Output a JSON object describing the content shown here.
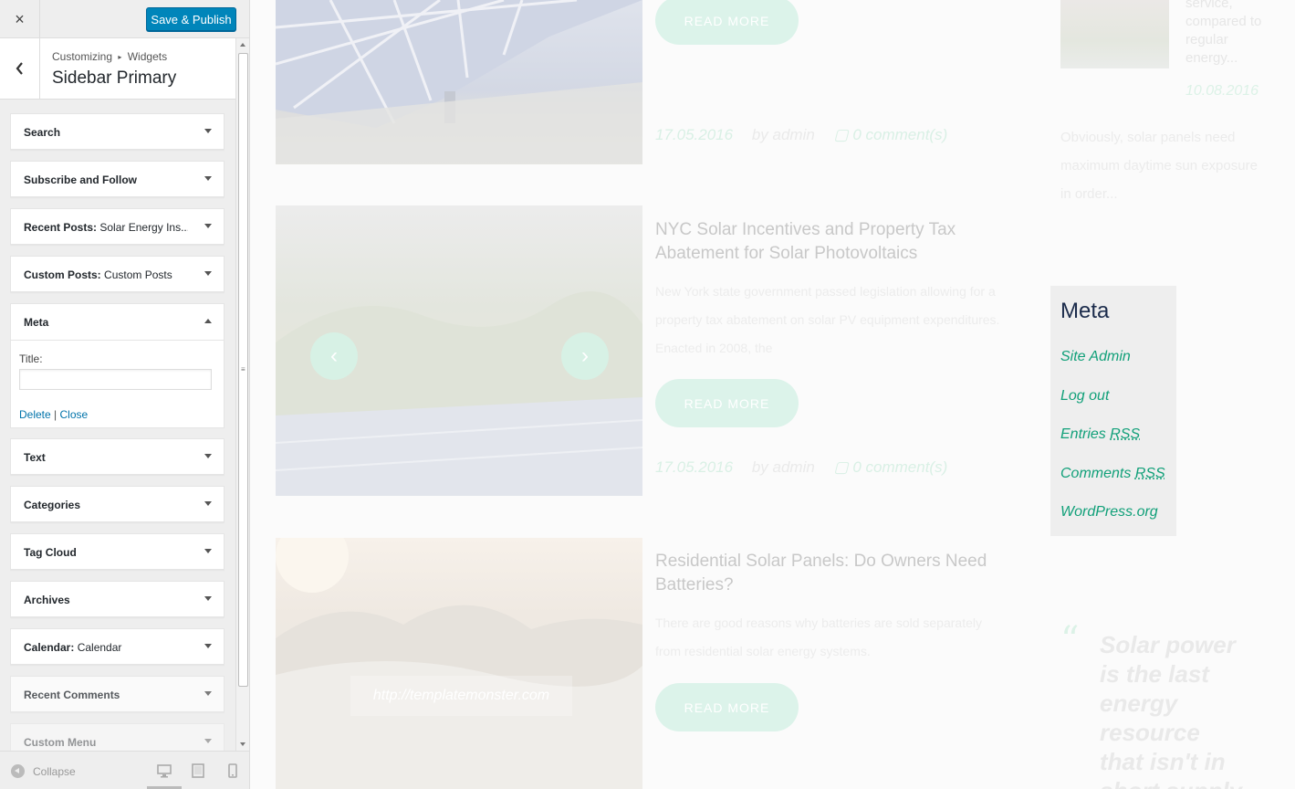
{
  "header": {
    "close_icon": "×",
    "save_label": "Save & Publish"
  },
  "section": {
    "breadcrumb_root": "Customizing",
    "breadcrumb_sep": "▸",
    "breadcrumb_leaf": "Widgets",
    "title": "Sidebar Primary"
  },
  "widgets": [
    {
      "label": "Search",
      "sub": ""
    },
    {
      "label": "Subscribe and Follow",
      "sub": ""
    },
    {
      "label": "Recent Posts:",
      "sub": " Solar Energy Ins..."
    },
    {
      "label": "Custom Posts:",
      "sub": " Custom Posts"
    },
    {
      "label": "Text",
      "sub": ""
    },
    {
      "label": "Categories",
      "sub": ""
    },
    {
      "label": "Tag Cloud",
      "sub": ""
    },
    {
      "label": "Archives",
      "sub": ""
    },
    {
      "label": "Calendar:",
      "sub": " Calendar"
    },
    {
      "label": "Recent Comments",
      "sub": ""
    },
    {
      "label": "Custom Menu",
      "sub": ""
    }
  ],
  "meta_widget": {
    "label": "Meta",
    "title_label": "Title:",
    "title_value": "",
    "delete_label": "Delete",
    "link_sep": " | ",
    "close_label": "Close"
  },
  "footer": {
    "collapse_label": "Collapse",
    "devices": [
      "desktop-icon",
      "tablet-icon",
      "mobile-icon"
    ]
  },
  "preview": {
    "posts": [
      {
        "title": "",
        "excerpt": "",
        "readmore": "READ MORE",
        "date": "17.05.2016",
        "author": "by admin",
        "comments": "0 comment(s)"
      },
      {
        "title": "NYC Solar Incentives and Property Tax Abatement for Solar Photovoltaics",
        "excerpt": "New York state government passed legislation allowing for a property tax abatement on solar PV equipment expenditures. Enacted in 2008, the",
        "readmore": "READ MORE",
        "date": "17.05.2016",
        "author": "by admin",
        "comments": "0 comment(s)"
      },
      {
        "title": "Residential Solar Panels: Do Owners Need Batteries?",
        "excerpt": "There are good reasons why batteries are sold separately from residential solar energy systems.",
        "readmore": "READ MORE"
      }
    ],
    "slider": {
      "prev": "‹",
      "next": "›"
    },
    "watermark": "http://templatemonster.com",
    "side_post": {
      "text": "service, compared to regular energy...",
      "date": "10.08.2016",
      "excerpt": "Obviously, solar panels need maximum daytime sun exposure in order..."
    },
    "meta_box": {
      "title": "Meta",
      "site_admin": "Site Admin",
      "log_out": "Log out",
      "entries": "Entries",
      "comments": "Comments",
      "rss": "RSS",
      "wordpress": "WordPress.org"
    },
    "quote": {
      "mark": "“",
      "text": "Solar power is the last energy resource that isn't in short supply"
    }
  }
}
